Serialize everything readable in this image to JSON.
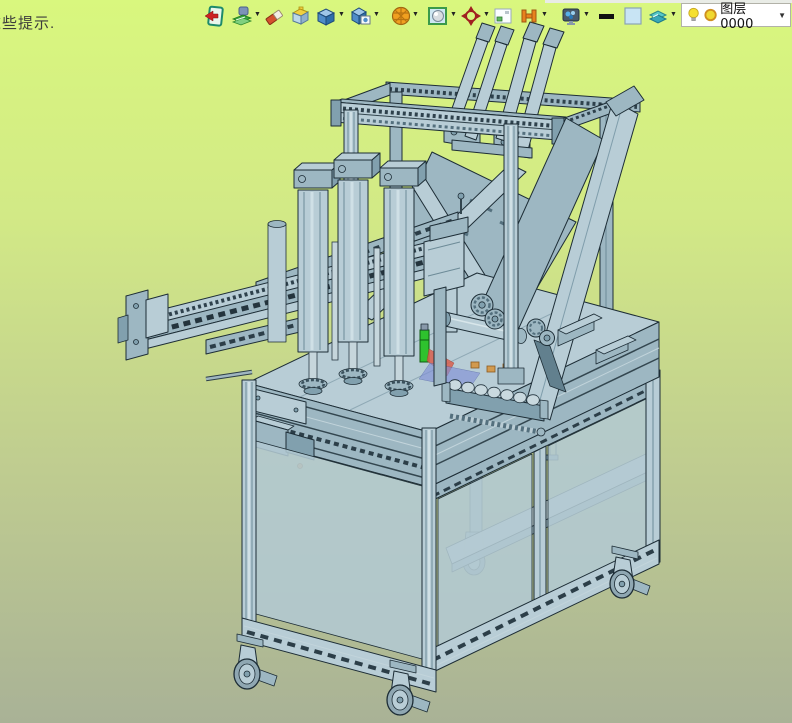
{
  "hint_text": "这些提示.",
  "ui": {
    "dropdown_glyph": "▼"
  },
  "toolbar": {
    "icons": [
      {
        "name": "exit-sketch",
        "dropdown": false
      },
      {
        "name": "render-layers",
        "dropdown": true
      },
      {
        "name": "eraser",
        "dropdown": false
      },
      {
        "name": "box-yellow-top",
        "dropdown": false
      },
      {
        "name": "solid-cube",
        "dropdown": true
      },
      {
        "name": "cube-viewport",
        "dropdown": true
      },
      {
        "name": "wireframe-sphere",
        "dropdown": true
      },
      {
        "name": "render-mode",
        "dropdown": true
      },
      {
        "name": "orientation-target",
        "dropdown": true
      },
      {
        "name": "sketch-plane",
        "dropdown": false
      },
      {
        "name": "section-beam",
        "dropdown": true
      },
      {
        "name": "material-preview",
        "dropdown": true
      },
      {
        "name": "line-width",
        "dropdown": false
      },
      {
        "name": "color-swatch",
        "dropdown": false
      },
      {
        "name": "layer-sheets",
        "dropdown": true
      }
    ],
    "layer_combo": {
      "value": "图层0000"
    }
  },
  "viewport": {
    "background_top": "#d9f77e",
    "background_bottom": "#a9b296",
    "model": {
      "name": "industrial-frame-machine",
      "body_color": "#9db7c2",
      "edge_color": "#1d2d36",
      "panel_color": "#b2c8d1",
      "accents": {
        "green_part": "#2ec22e",
        "red_beam": "#d95f4e",
        "blue_plate": "#8191d6",
        "orange_parts": "#d29a4f"
      }
    }
  }
}
